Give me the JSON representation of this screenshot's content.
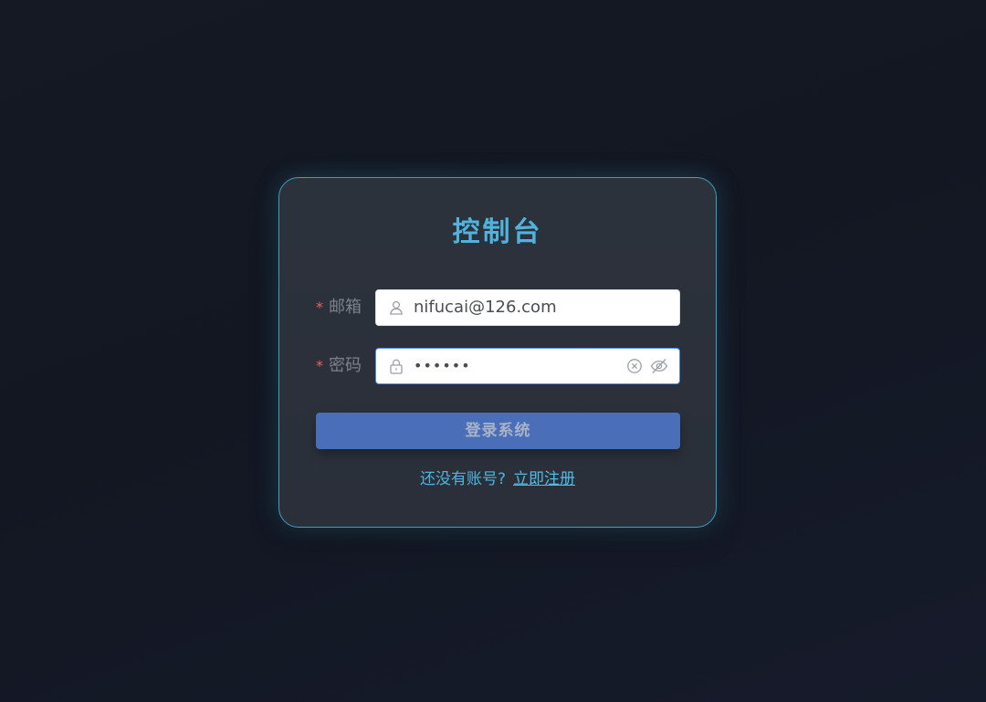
{
  "card": {
    "title": "控制台"
  },
  "form": {
    "email": {
      "required_mark": "*",
      "label": "邮箱",
      "value": "nifucai@126.com",
      "prefix_icon": "user-icon"
    },
    "password": {
      "required_mark": "*",
      "label": "密码",
      "value_masked": "••••••",
      "prefix_icon": "lock-icon",
      "clear_icon": "clear-circle-icon",
      "visibility_icon": "eye-off-icon"
    },
    "submit_label": "登录系统"
  },
  "register": {
    "prompt": "还没有账号?",
    "link_label": "立即注册"
  },
  "colors": {
    "accent": "#4fb3dd",
    "button": "#4a6fb8",
    "required": "#e0655b",
    "focus_border": "#4f8ef0"
  }
}
